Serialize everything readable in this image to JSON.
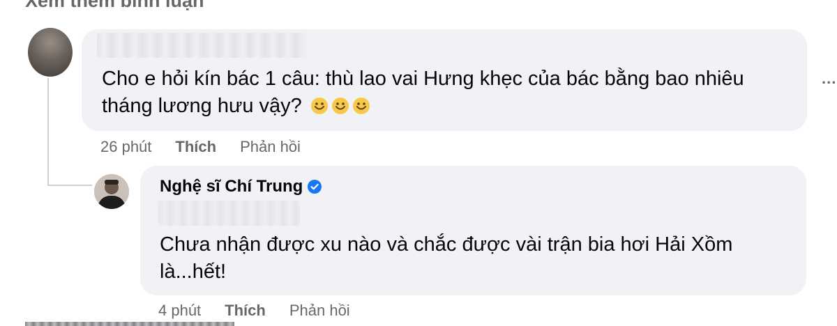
{
  "header": {
    "see_more_label": "Xem thêm bình luận"
  },
  "comments": [
    {
      "author_name": "",
      "text_lines": [
        "Cho e hỏi kín bác 1 câu: thù lao vai Hưng khẹc của bác bằng bao nhiêu",
        "tháng lương hưu vậy?"
      ],
      "emoji": [
        "smiling-face-icon",
        "smiling-face-icon",
        "smiling-face-icon"
      ],
      "time": "26 phút",
      "like_label": "Thích",
      "reply_label": "Phản hồi",
      "more_options": "..."
    },
    {
      "author_name": "Nghệ sĩ Chí Trung",
      "verified": true,
      "text_lines": [
        "Chưa nhận được xu nào và chắc được vài trận bia hơi Hải Xồm",
        "là...hết!"
      ],
      "time": "4 phút",
      "like_label": "Thích",
      "reply_label": "Phản hồi"
    }
  ],
  "colors": {
    "bubble_bg": "#f0f2f5",
    "secondary_text": "#65676b",
    "verified_blue": "#1877f2",
    "emoji_yellow": "#f7c948"
  }
}
